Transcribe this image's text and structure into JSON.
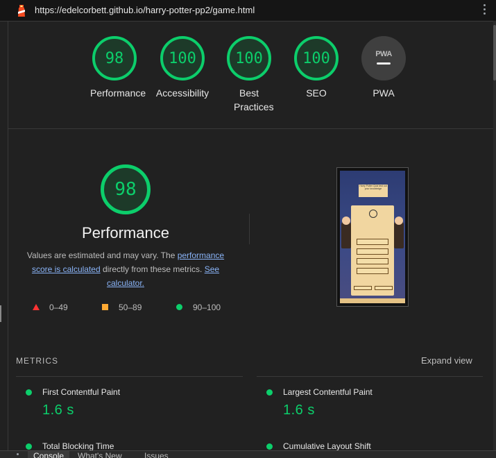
{
  "url": "https://edelcorbett.github.io/harry-potter-pp2/game.html",
  "gauges": [
    {
      "score": "98",
      "label": "Performance"
    },
    {
      "score": "100",
      "label": "Accessibility"
    },
    {
      "score": "100",
      "label": "Best Practices"
    },
    {
      "score": "100",
      "label": "SEO"
    },
    {
      "score": "",
      "label": "PWA",
      "badge": "PWA"
    }
  ],
  "performance": {
    "score": "98",
    "title": "Performance",
    "desc_1": "Values are estimated and may vary. The ",
    "link_1": "performance score is calculated",
    "desc_2": " directly from these metrics. ",
    "link_2": "See calculator."
  },
  "legend": [
    {
      "range": "0–49",
      "color": "#ff3333",
      "shape": "triangle"
    },
    {
      "range": "50–89",
      "color": "#ffaa33",
      "shape": "square"
    },
    {
      "range": "90–100",
      "color": "#0cce6b",
      "shape": "circle"
    }
  ],
  "thumbnail": {
    "title": "Harry Potter Quiz test out your knowledge",
    "question_label": "Question 1/10",
    "timer": "39",
    "score_label": "Score 0",
    "question": "What is the name of Harry Potter's owl?",
    "answers": [
      "Crookshanks",
      "Hen",
      "Hedwig",
      "Albus Dumbledore"
    ],
    "buttons": [
      "Go Home",
      "Next"
    ],
    "footer": "Created for education purpose only"
  },
  "metrics": {
    "heading": "METRICS",
    "expand_label": "Expand view",
    "items": [
      {
        "label": "First Contentful Paint",
        "value": "1.6 s"
      },
      {
        "label": "Largest Contentful Paint",
        "value": "1.6 s"
      },
      {
        "label": "Total Blocking Time",
        "value": ""
      },
      {
        "label": "Cumulative Layout Shift",
        "value": ""
      }
    ]
  },
  "drawer_tabs": [
    "Console",
    "What's New",
    "Issues"
  ],
  "colors": {
    "pass": "#0cce6b",
    "average": "#ffaa33",
    "fail": "#ff3333",
    "link": "#8ab4f8"
  }
}
